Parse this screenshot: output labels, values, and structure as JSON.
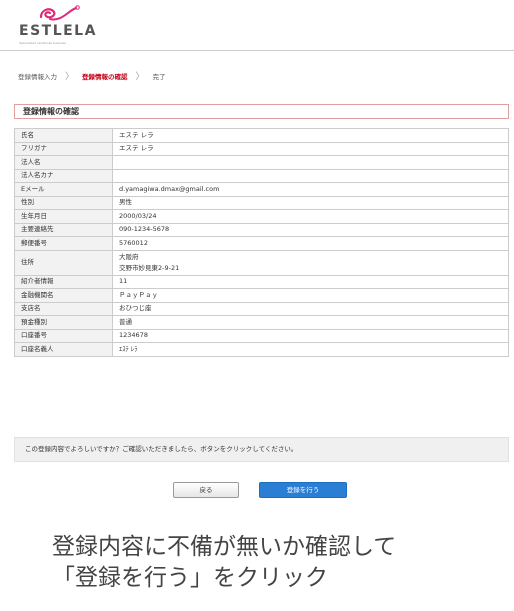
{
  "brand": {
    "name": "ESTLELA",
    "tagline": "Specialized dental lab business"
  },
  "breadcrumb": {
    "step1": "登録情報入力",
    "step2": "登録情報の確認",
    "step3": "完了"
  },
  "section_title": "登録情報の確認",
  "fields": [
    {
      "label": "氏名",
      "value": "エステ レラ"
    },
    {
      "label": "フリガナ",
      "value": "エステ レラ"
    },
    {
      "label": "法人名",
      "value": ""
    },
    {
      "label": "法人名カナ",
      "value": ""
    },
    {
      "label": "Eメール",
      "value": "d.yamagiwa.dmax@gmail.com"
    },
    {
      "label": "性別",
      "value": "男性"
    },
    {
      "label": "生年月日",
      "value": "2000/03/24"
    },
    {
      "label": "主要連絡先",
      "value": "090-1234-5678"
    },
    {
      "label": "郵便番号",
      "value": "5760012"
    },
    {
      "label": "住所",
      "value": "大阪府",
      "value2": "交野市妙見東2-9-21"
    },
    {
      "label": "紹介者情報",
      "value": "11"
    },
    {
      "label": "金融機関名",
      "value": "ＰａｙＰａｙ"
    },
    {
      "label": "支店名",
      "value": "おひつじ座"
    },
    {
      "label": "預金種別",
      "value": "普通"
    },
    {
      "label": "口座番号",
      "value": "1234678"
    },
    {
      "label": "口座名義人",
      "value": "ｴｽﾃ ﾚﾗ"
    }
  ],
  "notice": "この登録内容でよろしいですか？ご確認いただきましたら、ボタンをクリックしてください。",
  "buttons": {
    "back": "戻る",
    "submit": "登録を行う"
  },
  "caption": {
    "line1": "登録内容に不備が無いか確認して",
    "line2": "「登録を行う」をクリック"
  },
  "colors": {
    "accent": "#c40018",
    "button_blue": "#2a7fd4",
    "logo_pink": "#e0287a"
  }
}
